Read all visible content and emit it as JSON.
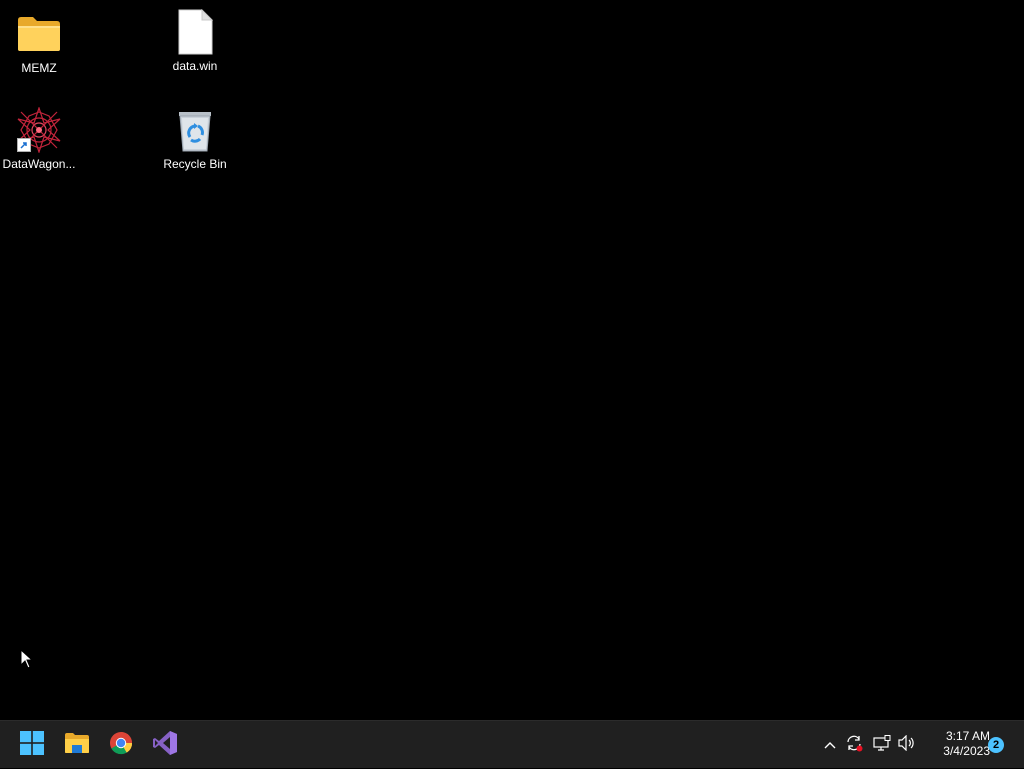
{
  "desktop": {
    "icons": [
      {
        "label": "MEMZ",
        "icon": "folder-icon"
      },
      {
        "label": "data.win",
        "icon": "file-icon"
      },
      {
        "label": "DataWagon...",
        "icon": "app-shortcut-icon"
      },
      {
        "label": "Recycle Bin",
        "icon": "recycle-bin-icon"
      }
    ]
  },
  "taskbar": {
    "apps": [
      {
        "name": "Start",
        "icon": "windows-start-icon"
      },
      {
        "name": "File Explorer",
        "icon": "file-explorer-icon"
      },
      {
        "name": "Google Chrome",
        "icon": "chrome-icon"
      },
      {
        "name": "Visual Studio",
        "icon": "visual-studio-icon"
      }
    ],
    "tray": {
      "time": "3:17 AM",
      "date": "3/4/2023",
      "notification_count": "2"
    }
  },
  "colors": {
    "desktop_bg": "#000000",
    "taskbar_bg": "#202020",
    "accent": "#4cc2ff"
  }
}
